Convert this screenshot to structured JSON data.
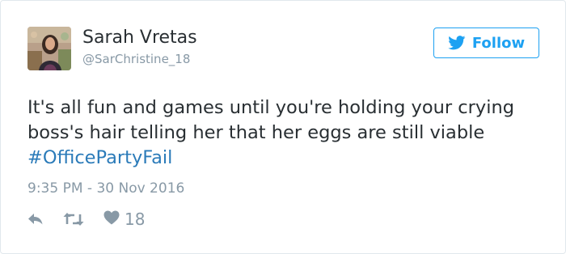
{
  "tweet": {
    "author": {
      "name": "Sarah Vretas",
      "handle": "@SarChristine_18"
    },
    "follow_label": "Follow",
    "text_before": "It's all fun and games until you're holding your crying boss's hair telling her that her eggs are still viable",
    "hashtag": "#OfficePartyFail",
    "timestamp": "9:35 PM - 30 Nov 2016",
    "actions": {
      "like_count": "18"
    }
  },
  "colors": {
    "accent": "#1da1f2",
    "hashtag": "#2b7bb9",
    "text": "#292f33",
    "muted": "#8899a6",
    "border": "#e1e8ed"
  },
  "icons": [
    "bird-icon",
    "reply-icon",
    "retweet-icon",
    "heart-icon"
  ]
}
